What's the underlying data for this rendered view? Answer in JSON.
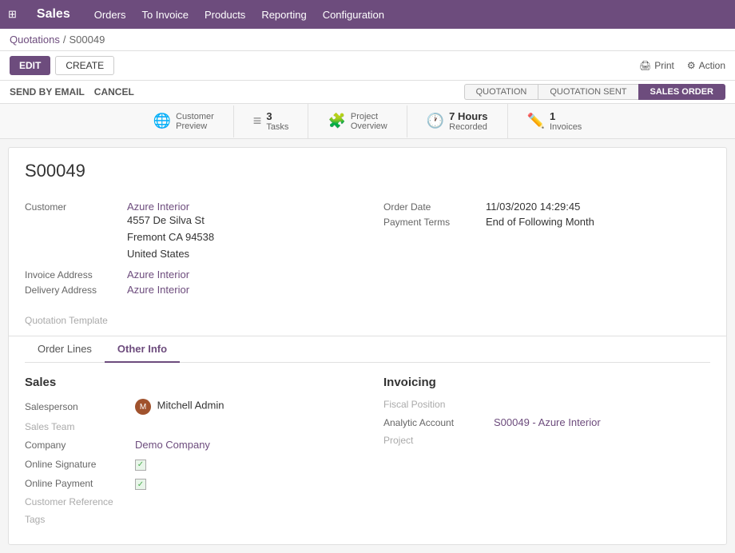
{
  "app": {
    "title": "Sales",
    "grid_icon": "⊞"
  },
  "nav": {
    "items": [
      "Orders",
      "To Invoice",
      "Products",
      "Reporting",
      "Configuration"
    ]
  },
  "breadcrumb": {
    "parent": "Quotations",
    "separator": "/",
    "current": "S00049"
  },
  "toolbar": {
    "edit_label": "EDIT",
    "create_label": "CREATE",
    "print_label": "Print",
    "action_label": "Action"
  },
  "status_bar": {
    "send_email_label": "SEND BY EMAIL",
    "cancel_label": "CANCEL",
    "steps": [
      {
        "key": "quotation",
        "label": "QUOTATION",
        "active": false
      },
      {
        "key": "quotation_sent",
        "label": "QUOTATION SENT",
        "active": false
      },
      {
        "key": "sales_order",
        "label": "SALES ORDER",
        "active": true
      }
    ]
  },
  "stats": [
    {
      "icon": "🌐",
      "num": "",
      "label": "Customer\nPreview",
      "key": "customer_preview"
    },
    {
      "icon": "≡",
      "num": "3",
      "label": "Tasks",
      "key": "tasks"
    },
    {
      "icon": "🧩",
      "num": "",
      "label": "Project\nOverview",
      "key": "project_overview"
    },
    {
      "icon": "🕐",
      "num": "7 Hours",
      "label": "Recorded",
      "key": "hours_recorded"
    },
    {
      "icon": "✏️",
      "num": "1",
      "label": "Invoices",
      "key": "invoices"
    }
  ],
  "order": {
    "id": "S00049",
    "customer_label": "Customer",
    "customer_name": "Azure Interior",
    "customer_address_line1": "4557 De Silva St",
    "customer_address_line2": "Fremont CA 94538",
    "customer_address_line3": "United States",
    "invoice_address_label": "Invoice Address",
    "invoice_address_value": "Azure Interior",
    "delivery_address_label": "Delivery Address",
    "delivery_address_value": "Azure Interior",
    "quotation_template_label": "Quotation Template",
    "order_date_label": "Order Date",
    "order_date_value": "11/03/2020 14:29:45",
    "payment_terms_label": "Payment Terms",
    "payment_terms_value": "End of Following Month"
  },
  "tabs": [
    {
      "key": "order_lines",
      "label": "Order Lines"
    },
    {
      "key": "other_info",
      "label": "Other Info"
    }
  ],
  "other_info": {
    "sales_section_title": "Sales",
    "salesperson_label": "Salesperson",
    "salesperson_name": "Mitchell Admin",
    "salesperson_avatar_initial": "M",
    "sales_team_label": "Sales Team",
    "sales_team_value": "",
    "company_label": "Company",
    "company_value": "Demo Company",
    "online_signature_label": "Online Signature",
    "online_payment_label": "Online Payment",
    "customer_reference_label": "Customer Reference",
    "tags_label": "Tags",
    "invoicing_section_title": "Invoicing",
    "fiscal_position_label": "Fiscal Position",
    "fiscal_position_value": "",
    "analytic_account_label": "Analytic Account",
    "analytic_account_value": "S00049 - Azure Interior",
    "project_label": "Project",
    "project_value": ""
  }
}
